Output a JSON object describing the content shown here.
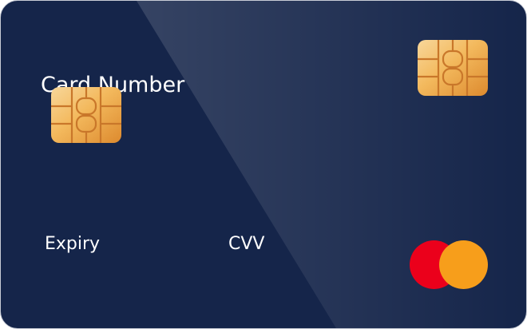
{
  "card": {
    "card_number_label": "Card Number",
    "expiry_label": "Expiry",
    "cvv_label": "CVV",
    "chip_icon": "emv-chip-icon",
    "brand_icon": "mastercard-logo-icon"
  },
  "colors": {
    "card_background": "#15254a",
    "text": "#ffffff",
    "chip_gold": "#f2b75a",
    "mastercard_red": "#eb001b",
    "mastercard_orange": "#f79e1b"
  }
}
